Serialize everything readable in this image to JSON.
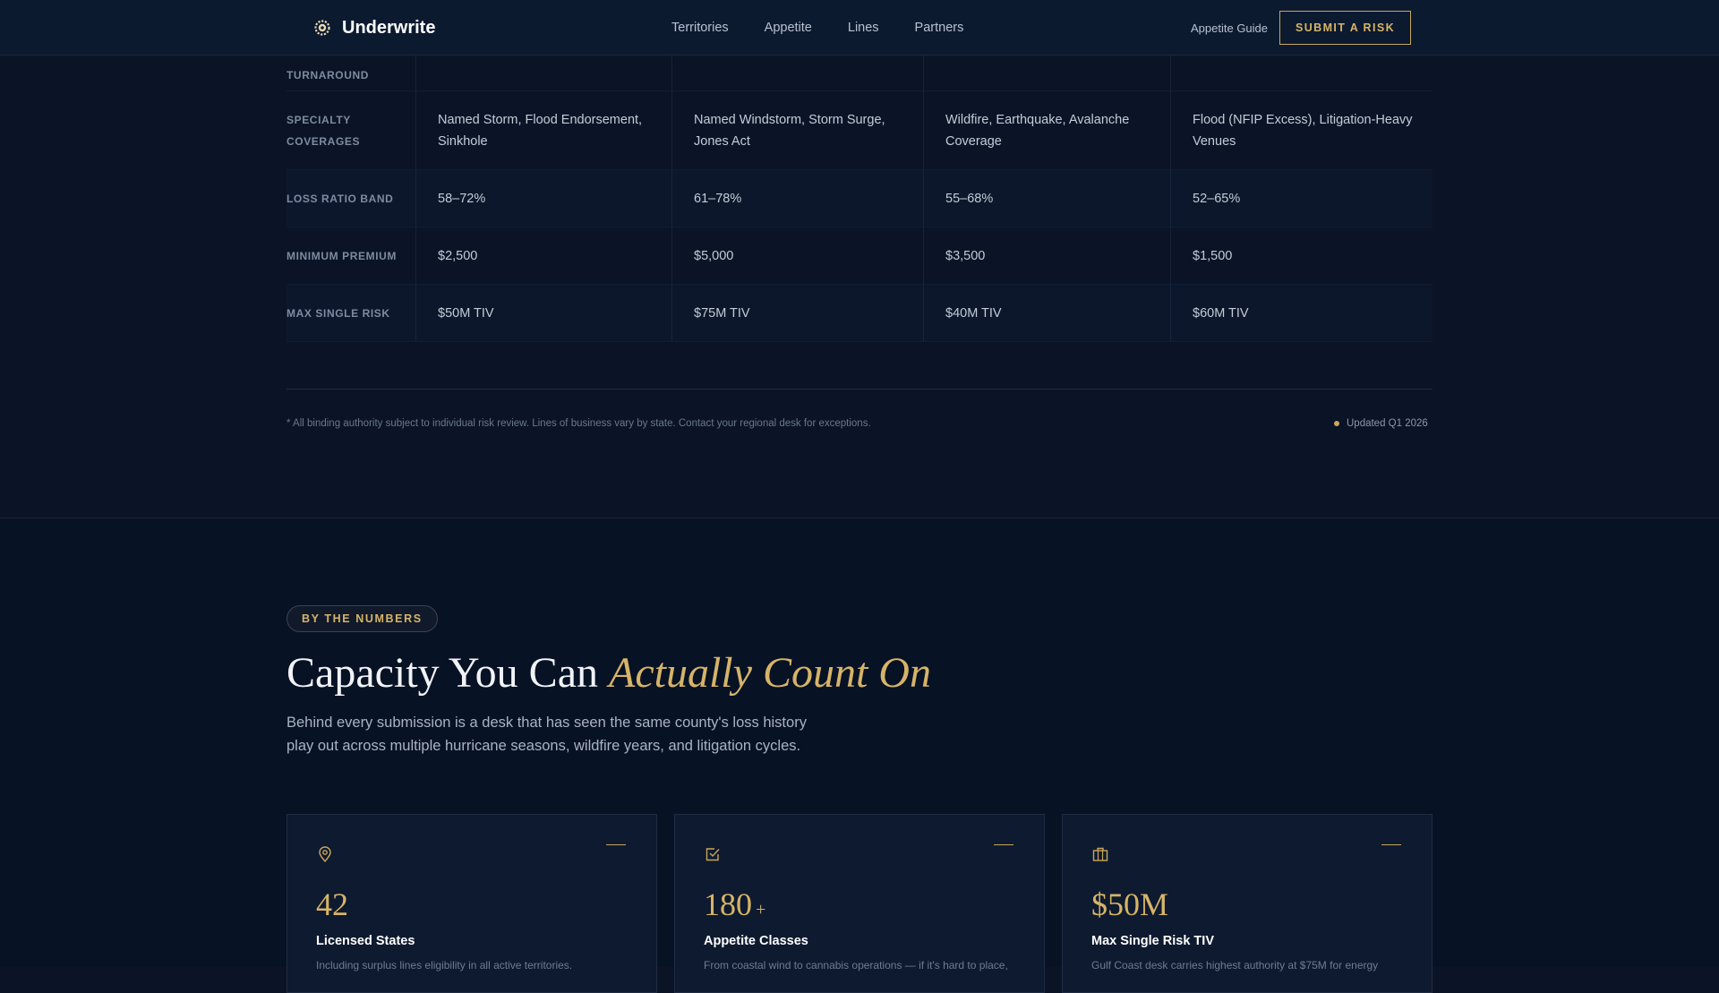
{
  "nav": {
    "brand": "Underwrite",
    "links": [
      "Territories",
      "Appetite",
      "Lines",
      "Partners"
    ],
    "guide": "Appetite Guide",
    "cta": "SUBMIT A RISK"
  },
  "table": {
    "rows": [
      {
        "label": "TURNAROUND",
        "cells": [
          "",
          "",
          "",
          ""
        ]
      },
      {
        "label": "SPECIALTY COVERAGES",
        "cells": [
          "Named Storm, Flood Endorsement, Sinkhole",
          "Named Windstorm, Storm Surge, Jones Act",
          "Wildfire, Earthquake, Avalanche Coverage",
          "Flood (NFIP Excess), Litigation-Heavy Venues"
        ]
      },
      {
        "label": "LOSS RATIO BAND",
        "cells": [
          "58–72%",
          "61–78%",
          "55–68%",
          "52–65%"
        ]
      },
      {
        "label": "MINIMUM PREMIUM",
        "cells": [
          "$2,500",
          "$5,000",
          "$3,500",
          "$1,500"
        ]
      },
      {
        "label": "MAX SINGLE RISK",
        "cells": [
          "$50M TIV",
          "$75M TIV",
          "$40M TIV",
          "$60M TIV"
        ]
      }
    ],
    "footnote": "* All binding authority subject to individual risk review. Lines of business vary by state. Contact your regional desk for exceptions.",
    "updated": "Updated Q1 2026"
  },
  "numbers": {
    "badge": "BY THE NUMBERS",
    "headline_plain": "Capacity You Can ",
    "headline_accent": "Actually Count On",
    "lede": "Behind every submission is a desk that has seen the same county's loss history play out across multiple hurricane seasons, wildfire years, and litigation cycles.",
    "cards": [
      {
        "icon": "map-pin-icon",
        "value": "42",
        "suffix": "",
        "label": "Licensed States",
        "desc": "Including surplus lines eligibility in all active territories."
      },
      {
        "icon": "check-square-icon",
        "value": "180",
        "suffix": "+",
        "label": "Appetite Classes",
        "desc": "From coastal wind to cannabis operations — if it's hard to place,"
      },
      {
        "icon": "briefcase-icon",
        "value": "$50M",
        "suffix": "",
        "label": "Max Single Risk TIV",
        "desc": "Gulf Coast desk carries highest authority at $75M for energy"
      }
    ]
  },
  "colors": {
    "accent": "#c9a75c",
    "background": "#0a1426",
    "card": "#0e1a2f"
  }
}
